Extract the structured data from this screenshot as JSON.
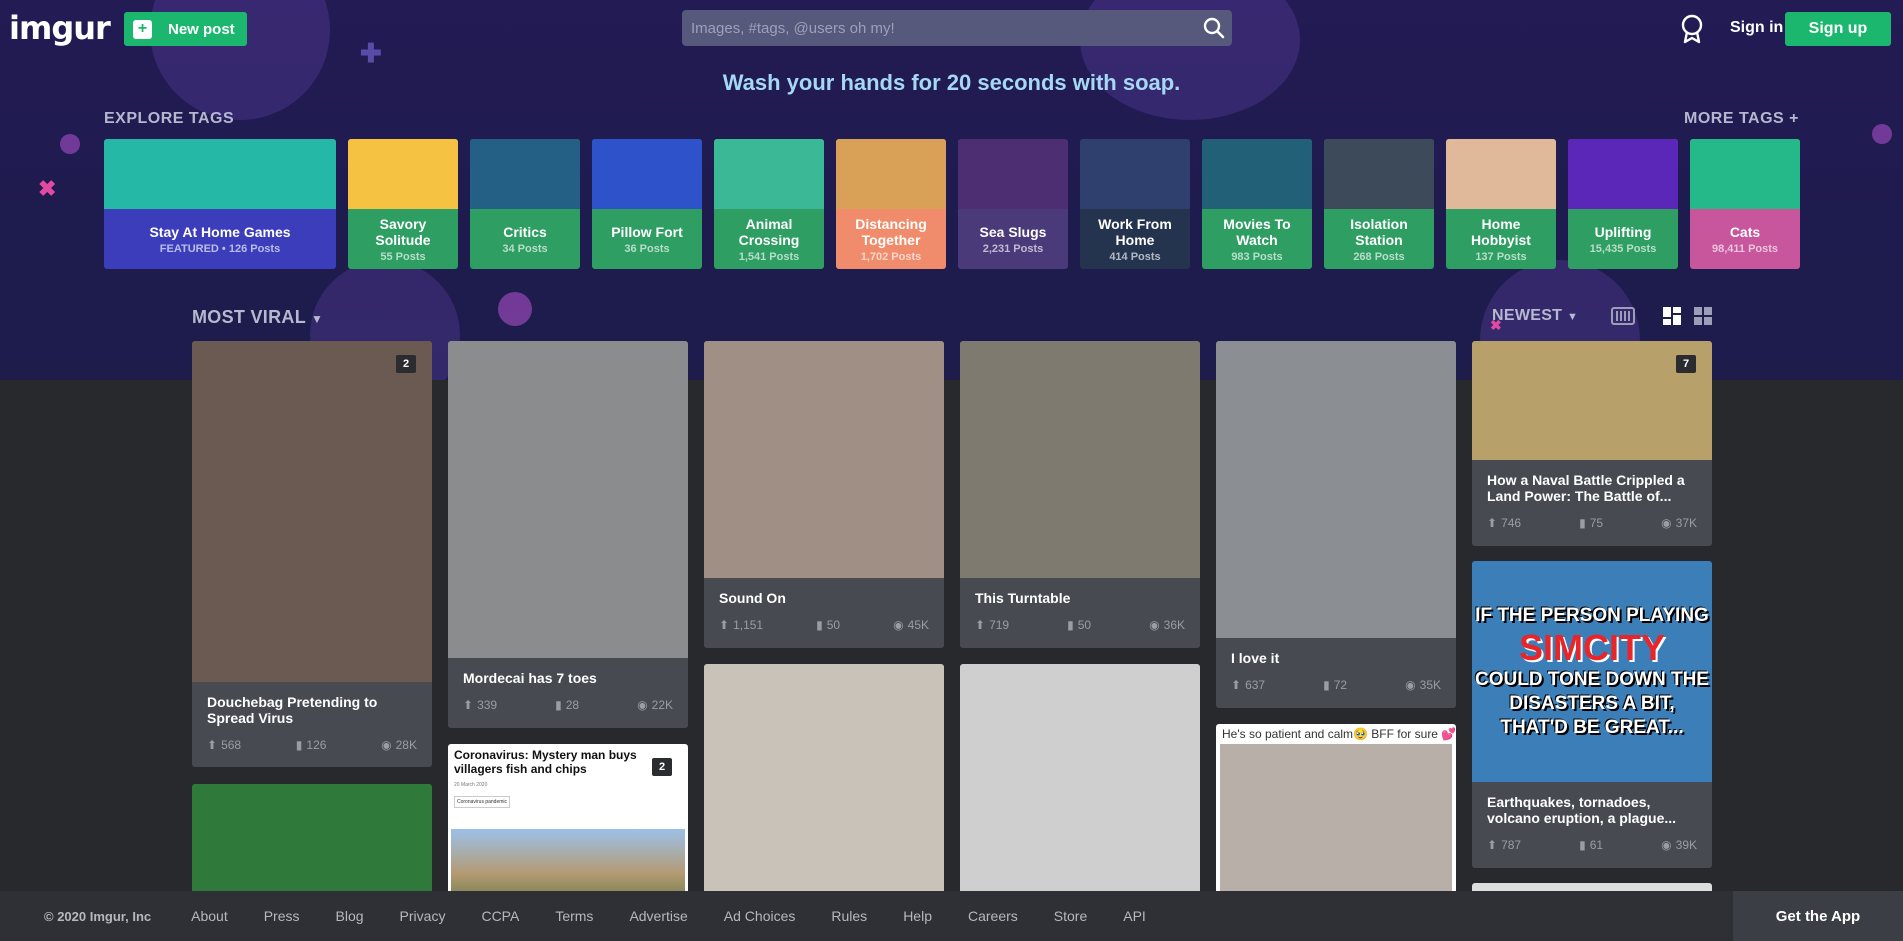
{
  "header": {
    "logo": "imgur",
    "new_post": "New post",
    "search_placeholder": "Images, #tags, @users oh my!",
    "sign_in": "Sign in",
    "sign_up": "Sign up"
  },
  "banner": "Wash your hands for 20 seconds with soap.",
  "explore": {
    "title": "EXPLORE TAGS",
    "more": "MORE TAGS +",
    "tags": [
      {
        "name": "Stay At Home Games",
        "count": "FEATURED • 126 Posts",
        "color": "#3b3dba",
        "img": "#26b8a6"
      },
      {
        "name": "Savory Solitude",
        "count": "55 Posts",
        "color": "#2e9e63",
        "img": "#f5c242"
      },
      {
        "name": "Critics",
        "count": "34 Posts",
        "color": "#2e9e63",
        "img": "#245f86"
      },
      {
        "name": "Pillow Fort",
        "count": "36 Posts",
        "color": "#2e9e63",
        "img": "#2d52c9"
      },
      {
        "name": "Animal Crossing",
        "count": "1,541 Posts",
        "color": "#2e9e63",
        "img": "#3bb996"
      },
      {
        "name": "Distancing Together",
        "count": "1,702 Posts",
        "color": "#f08c6b",
        "img": "#d9a058"
      },
      {
        "name": "Sea Slugs",
        "count": "2,231 Posts",
        "color": "#4a3a7a",
        "img": "#4d2e72"
      },
      {
        "name": "Work From Home",
        "count": "414 Posts",
        "color": "#24344f",
        "img": "#2f3f6e"
      },
      {
        "name": "Movies To Watch",
        "count": "983 Posts",
        "color": "#2e9e63",
        "img": "#226078"
      },
      {
        "name": "Isolation Station",
        "count": "268 Posts",
        "color": "#2e9e63",
        "img": "#3c4a5a"
      },
      {
        "name": "Home Hobbyist",
        "count": "137 Posts",
        "color": "#2e9e63",
        "img": "#e0b99a"
      },
      {
        "name": "Uplifting",
        "count": "15,435 Posts",
        "color": "#2e9e63",
        "img": "#5a27b8"
      },
      {
        "name": "Cats",
        "count": "98,411 Posts",
        "color": "#c7569c",
        "img": "#25b98a"
      }
    ]
  },
  "sort": {
    "section": "MOST VIRAL",
    "order": "NEWEST"
  },
  "posts": [
    {
      "title": "Douchebag Pretending to Spread Virus",
      "ups": "568",
      "comments": "126",
      "views": "28K",
      "badge": "2",
      "img": "#6a5a52"
    },
    {
      "title": "Mordecai has 7 toes",
      "ups": "339",
      "comments": "28",
      "views": "22K",
      "badge": "",
      "img": "#8a8c8e"
    },
    {
      "title": "Sound On",
      "ups": "1,151",
      "comments": "50",
      "views": "45K",
      "badge": "",
      "img": "#a08f84"
    },
    {
      "title": "This Turntable",
      "ups": "719",
      "comments": "50",
      "views": "36K",
      "badge": "",
      "img": "#7f7a70"
    },
    {
      "title": "I love it",
      "ups": "637",
      "comments": "72",
      "views": "35K",
      "badge": "",
      "img": "#8b8e92"
    },
    {
      "title": "How a Naval Battle Crippled a Land Power: The Battle of...",
      "ups": "746",
      "comments": "75",
      "views": "37K",
      "badge": "7",
      "img": "#b7a06a"
    },
    {
      "title": "Earthquakes, tornadoes, volcano eruption, a plague...",
      "ups": "787",
      "comments": "61",
      "views": "39K",
      "badge": "",
      "img": "#3c7fb8",
      "meme": [
        "IF THE PERSON PLAYING",
        "SIMCITY",
        "COULD TONE DOWN THE",
        "DISASTERS A BIT,",
        "THAT'D BE GREAT..."
      ]
    },
    {
      "title": "",
      "badge": "",
      "img": "#2f7a3a"
    },
    {
      "title": "",
      "badge": "2",
      "img": "#ffffff",
      "headline": "Coronavirus: Mystery man buys villagers fish and chips",
      "date": "20 March 2020",
      "tag": "Coronavirus pandemic"
    },
    {
      "title": "",
      "badge": "",
      "img": "#c9c2b8"
    },
    {
      "title": "",
      "badge": "",
      "img": "#cfcfcf"
    },
    {
      "title": "",
      "badge": "",
      "img": "#b8b0a8",
      "caption": "He's so patient and calm🥹 BFF for sure 💕"
    }
  ],
  "footer": {
    "copyright": "© 2020 Imgur, Inc",
    "links": [
      "About",
      "Press",
      "Blog",
      "Privacy",
      "CCPA",
      "Terms",
      "Advertise",
      "Ad Choices",
      "Rules",
      "Help",
      "Careers",
      "Store",
      "API"
    ],
    "get_app": "Get the App"
  }
}
